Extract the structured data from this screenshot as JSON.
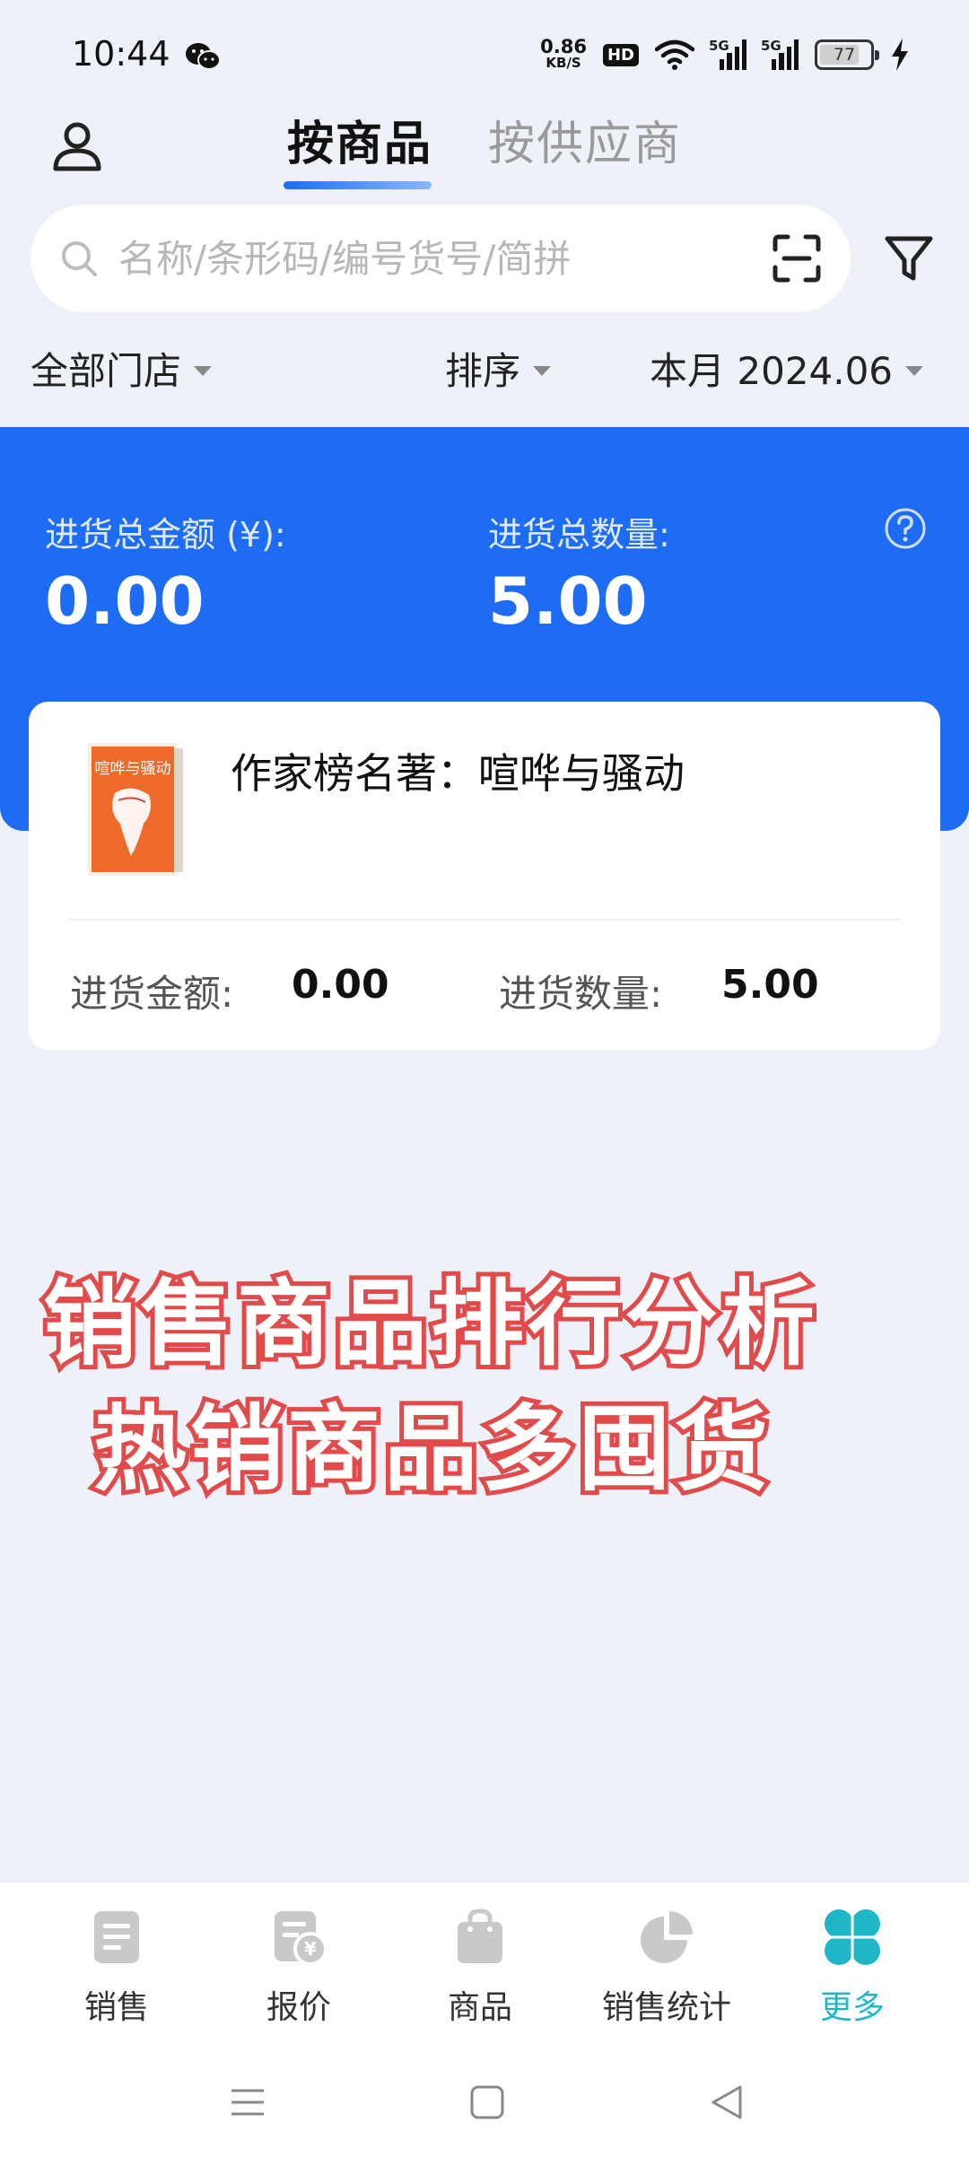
{
  "status_bar": {
    "time": "10:44",
    "net_speed_value": "0.86",
    "net_speed_unit": "KB/S",
    "hd_label": "HD",
    "signal_1_label": "5G",
    "signal_2_label": "5G",
    "battery_level": "77"
  },
  "header": {
    "tabs": [
      {
        "label": "按商品",
        "active": true
      },
      {
        "label": "按供应商",
        "active": false
      }
    ]
  },
  "search": {
    "placeholder": "名称/条形码/编号货号/简拼",
    "value": ""
  },
  "filters": {
    "store": "全部门店",
    "sort": "排序",
    "period": "本月 2024.06"
  },
  "summary": {
    "total_amount_label": "进货总金额 (¥):",
    "total_amount_value": "0.00",
    "total_quantity_label": "进货总数量:",
    "total_quantity_value": "5.00"
  },
  "product": {
    "name": "作家榜名著：喧哗与骚动",
    "cover_title": "喧哗与骚动",
    "amount_label": "进货金额:",
    "amount_value": "0.00",
    "quantity_label": "进货数量:",
    "quantity_value": "5.00"
  },
  "promo": {
    "line1": "销售商品排行分析",
    "line2": "热销商品多囤货"
  },
  "bottom_nav": {
    "items": [
      {
        "label": "销售",
        "icon": "document-icon",
        "active": false
      },
      {
        "label": "报价",
        "icon": "price-tag-icon",
        "active": false
      },
      {
        "label": "商品",
        "icon": "shopping-bag-icon",
        "active": false
      },
      {
        "label": "销售统计",
        "icon": "pie-chart-icon",
        "active": false
      },
      {
        "label": "更多",
        "icon": "clover-icon",
        "active": true
      }
    ]
  },
  "colors": {
    "accent_blue": "#1f6cf4",
    "active_teal": "#1fb6c8",
    "promo_red": "#e14b4b"
  }
}
